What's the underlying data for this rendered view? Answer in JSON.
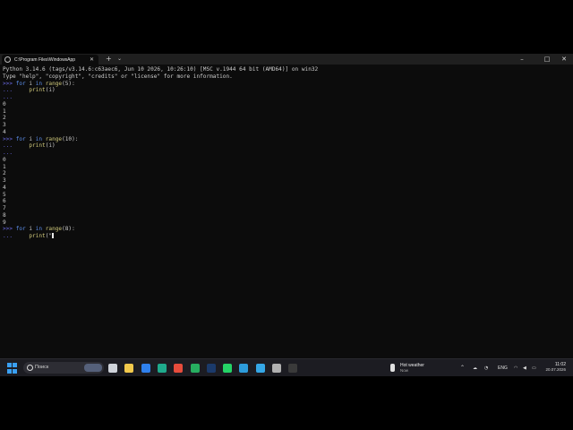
{
  "window": {
    "tab_title": "C:\\Program Files\\WindowsApp",
    "tab_close": "✕",
    "new_tab": "+",
    "tab_dropdown": "⌄",
    "minimize": "–",
    "maximize": "□",
    "close": "✕"
  },
  "terminal": {
    "lines": [
      [
        {
          "t": "Python 3.14.6 (tags/v3.14.6:c63aec6, Jun 10 2026, 10:26:10) [MSC v.1944 64 bit (AMD64)] on win32",
          "c": "nm"
        }
      ],
      [
        {
          "t": "Type \"help\", \"copyright\", \"credits\" or \"license\" for more information.",
          "c": "nm"
        }
      ],
      [
        {
          "t": ">>> ",
          "c": "prompt"
        },
        {
          "t": "for",
          "c": "kw"
        },
        {
          "t": " i ",
          "c": "nm"
        },
        {
          "t": "in",
          "c": "kw"
        },
        {
          "t": " ",
          "c": "nm"
        },
        {
          "t": "range",
          "c": "fn"
        },
        {
          "t": "(5):",
          "c": "nm"
        }
      ],
      [
        {
          "t": "...     ",
          "c": "cont"
        },
        {
          "t": "print",
          "c": "fn"
        },
        {
          "t": "(i)",
          "c": "nm"
        }
      ],
      [
        {
          "t": "...",
          "c": "cont"
        }
      ],
      [
        {
          "t": "0",
          "c": "nm"
        }
      ],
      [
        {
          "t": "1",
          "c": "nm"
        }
      ],
      [
        {
          "t": "2",
          "c": "nm"
        }
      ],
      [
        {
          "t": "3",
          "c": "nm"
        }
      ],
      [
        {
          "t": "4",
          "c": "nm"
        }
      ],
      [
        {
          "t": ">>> ",
          "c": "prompt"
        },
        {
          "t": "for",
          "c": "kw"
        },
        {
          "t": " i ",
          "c": "nm"
        },
        {
          "t": "in",
          "c": "kw"
        },
        {
          "t": " ",
          "c": "nm"
        },
        {
          "t": "range",
          "c": "fn"
        },
        {
          "t": "(10):",
          "c": "nm"
        }
      ],
      [
        {
          "t": "...     ",
          "c": "cont"
        },
        {
          "t": "print",
          "c": "fn"
        },
        {
          "t": "(i)",
          "c": "nm"
        }
      ],
      [
        {
          "t": "...",
          "c": "cont"
        }
      ],
      [
        {
          "t": "0",
          "c": "nm"
        }
      ],
      [
        {
          "t": "1",
          "c": "nm"
        }
      ],
      [
        {
          "t": "2",
          "c": "nm"
        }
      ],
      [
        {
          "t": "3",
          "c": "nm"
        }
      ],
      [
        {
          "t": "4",
          "c": "nm"
        }
      ],
      [
        {
          "t": "5",
          "c": "nm"
        }
      ],
      [
        {
          "t": "6",
          "c": "nm"
        }
      ],
      [
        {
          "t": "7",
          "c": "nm"
        }
      ],
      [
        {
          "t": "8",
          "c": "nm"
        }
      ],
      [
        {
          "t": "9",
          "c": "nm"
        }
      ],
      [
        {
          "t": ">>> ",
          "c": "prompt"
        },
        {
          "t": "for",
          "c": "kw"
        },
        {
          "t": " i ",
          "c": "nm"
        },
        {
          "t": "in",
          "c": "kw"
        },
        {
          "t": " ",
          "c": "nm"
        },
        {
          "t": "range",
          "c": "fn"
        },
        {
          "t": "(8):",
          "c": "nm"
        }
      ],
      [
        {
          "t": "...     ",
          "c": "cont"
        },
        {
          "t": "print",
          "c": "fn"
        },
        {
          "t": "(\"",
          "c": "nm"
        },
        {
          "t": "",
          "c": "cursor"
        }
      ]
    ]
  },
  "taskbar": {
    "search_placeholder": "Поиск",
    "apps": [
      {
        "icon": "task-view-icon",
        "color": "#cfd3da"
      },
      {
        "icon": "file-explorer-icon",
        "color": "#f2c94c"
      },
      {
        "icon": "onedrive-icon",
        "color": "#2f80ed"
      },
      {
        "icon": "edge-icon",
        "color": "#1faa8c"
      },
      {
        "icon": "chrome-icon",
        "color": "#e74c3c"
      },
      {
        "icon": "spreadsheet-icon",
        "color": "#27ae60"
      },
      {
        "icon": "photoshop-icon",
        "color": "#1b3a6b"
      },
      {
        "icon": "whatsapp-icon",
        "color": "#25d366"
      },
      {
        "icon": "phone-link-icon",
        "color": "#2d9cdb"
      },
      {
        "icon": "azure-icon",
        "color": "#35a7e6"
      },
      {
        "icon": "settings-icon",
        "color": "#b0b0b0"
      },
      {
        "icon": "terminal-icon",
        "color": "#3a3a3a"
      }
    ],
    "weather_title": "Hot weather",
    "weather_sub": "Now",
    "language": "ENG",
    "time": "11:02",
    "date": "20.07.2026"
  }
}
